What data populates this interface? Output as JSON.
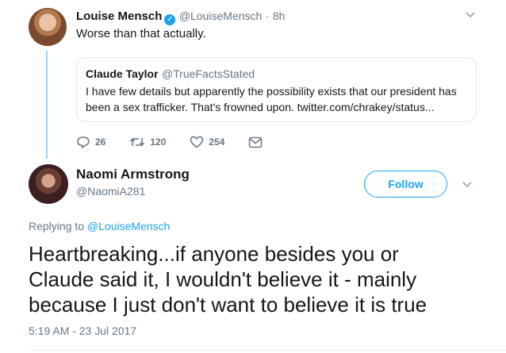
{
  "parent_tweet": {
    "name": "Louise Mensch",
    "handle": "@LouiseMensch",
    "separator": "·",
    "time": "8h",
    "text": "Worse than that actually.",
    "quoted": {
      "name": "Claude Taylor",
      "handle": "@TrueFactsStated",
      "text_line1": "I have few details but apparently the possibility exists that our president has",
      "text_line2": "been a sex trafficker. That's frowned upon. twitter.com/chrakey/status..."
    },
    "actions": {
      "replies": "26",
      "retweets": "120",
      "likes": "254"
    }
  },
  "main_tweet": {
    "name": "Naomi Armstrong",
    "handle": "@NaomiA281",
    "follow_label": "Follow",
    "replying_prefix": "Replying to",
    "replying_handle": "@LouiseMensch",
    "text_line1": "Heartbreaking...if anyone besides you or",
    "text_line2": "Claude said it, I wouldn't believe it - mainly",
    "text_line3": "because I just don't want to believe it is true",
    "timestamp": "5:19 AM - 23 Jul 2017"
  },
  "colors": {
    "accent": "#1da1f2",
    "muted": "#657786",
    "thread_line": "#9fd0f2"
  }
}
